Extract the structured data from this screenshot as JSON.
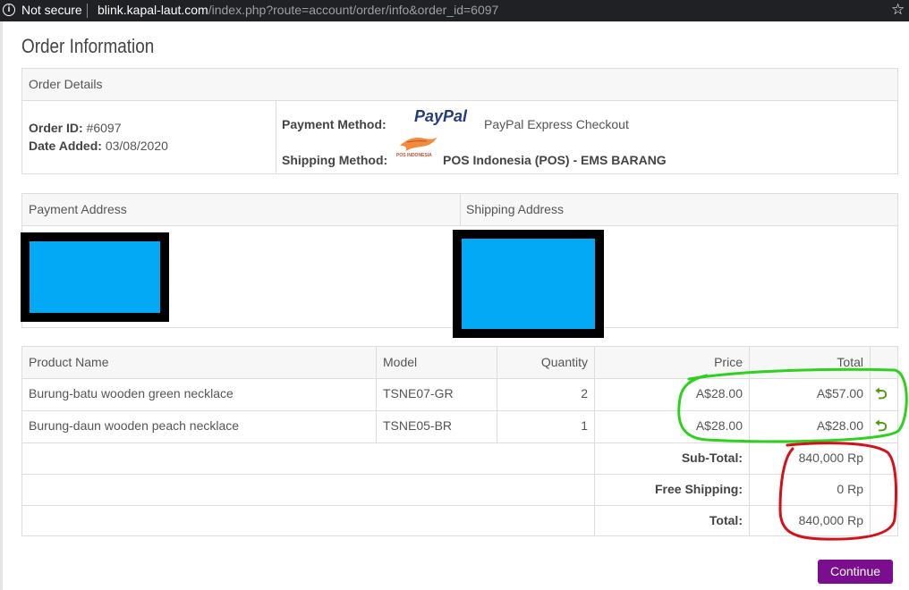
{
  "browser": {
    "security": "Not secure",
    "url_host": "blink.kapal-laut.com",
    "url_path": "/index.php?route=account/order/info&order_id=6097"
  },
  "page": {
    "title": "Order Information"
  },
  "order_details": {
    "heading": "Order Details",
    "order_id_label": "Order ID:",
    "order_id": "#6097",
    "date_label": "Date Added:",
    "date": "03/08/2020",
    "payment_label": "Payment Method:",
    "payment_logo": "PayPal",
    "payment_value": "PayPal Express Checkout",
    "shipping_label": "Shipping Method:",
    "shipping_logo_text": "POS INDONESIA",
    "shipping_value": "POS Indonesia (POS) - EMS BARANG"
  },
  "addresses": {
    "payment_heading": "Payment Address",
    "shipping_heading": "Shipping Address"
  },
  "products": {
    "columns": {
      "name": "Product Name",
      "model": "Model",
      "qty": "Quantity",
      "price": "Price",
      "total": "Total"
    },
    "rows": [
      {
        "name": "Burung-batu wooden green necklace",
        "model": "TSNE07-GR",
        "qty": "2",
        "price": "A$28.00",
        "total": "A$57.00"
      },
      {
        "name": "Burung-daun wooden peach necklace",
        "model": "TSNE05-BR",
        "qty": "1",
        "price": "A$28.00",
        "total": "A$28.00"
      }
    ]
  },
  "totals": [
    {
      "label": "Sub-Total:",
      "value": "840,000 Rp"
    },
    {
      "label": "Free Shipping:",
      "value": "0 Rp"
    },
    {
      "label": "Total:",
      "value": "840,000 Rp"
    }
  ],
  "actions": {
    "continue": "Continue"
  },
  "icons": {
    "return": "return-icon",
    "info": "info-icon",
    "star": "star-icon"
  },
  "colors": {
    "button": "#7b0d8f",
    "annotation_green": "#2fd11f",
    "annotation_red": "#d3111b",
    "redaction": "#03a9f4"
  }
}
